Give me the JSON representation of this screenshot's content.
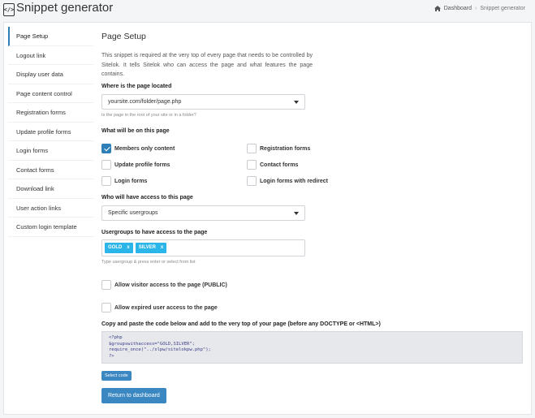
{
  "app": {
    "title": "Snippet generator",
    "logo_icon": "code-file-icon"
  },
  "breadcrumb": {
    "home": "Dashboard",
    "separator": "›",
    "current": "Snippet generator"
  },
  "sidebar": {
    "items": [
      {
        "label": "Page Setup",
        "active": true
      },
      {
        "label": "Logout link"
      },
      {
        "label": "Display user data"
      },
      {
        "label": "Page content control"
      },
      {
        "label": "Registration forms"
      },
      {
        "label": "Update profile forms"
      },
      {
        "label": "Login forms"
      },
      {
        "label": "Contact forms"
      },
      {
        "label": "Download link"
      },
      {
        "label": "User action links"
      },
      {
        "label": "Custom login template"
      }
    ]
  },
  "main": {
    "title": "Page Setup",
    "intro": "This snippet is required at the very top of every page that needs to be controlled by Sitelok. It tells Sitelok who can access the page and what features the page contains.",
    "location": {
      "label": "Where is the page located",
      "value": "yoursite.com/folder/page.php",
      "hint": "Is the page in the root of your site or in a folder?"
    },
    "features": {
      "label": "What will be on this page",
      "options": [
        {
          "label": "Members only content",
          "checked": true
        },
        {
          "label": "Registration forms",
          "checked": false
        },
        {
          "label": "Update profile forms",
          "checked": false
        },
        {
          "label": "Contact forms",
          "checked": false
        },
        {
          "label": "Login forms",
          "checked": false
        },
        {
          "label": "Login forms with redirect",
          "checked": false
        }
      ]
    },
    "access": {
      "label": "Who will have access to this page",
      "value": "Specific usergroups"
    },
    "usergroups": {
      "label": "Usergroups to have access to the page",
      "tags": [
        "GOLD",
        "SILVER"
      ],
      "remove_glyph": "x",
      "hint": "Type usergroup & press enter or select from list"
    },
    "public_access": {
      "label": "Allow visitor access to the page (PUBLIC)",
      "checked": false
    },
    "expired_access": {
      "label": "Allow expired user access to the page",
      "checked": false
    },
    "code": {
      "label": "Copy and paste the code below and add to the very top of your page (before any DOCTYPE or <HTML>)",
      "lines": [
        "<?php",
        "$groupswithaccess=\"GOLD,SILVER\";",
        "require_once(\"../slpw/sitelokpw.php\");",
        "?>"
      ]
    },
    "select_code_label": "Select code",
    "return_label": "Return to dashboard"
  },
  "colors": {
    "accent": "#3a87c2",
    "tag": "#2bb5e8",
    "checkbox_checked": "#2e7fb8"
  }
}
